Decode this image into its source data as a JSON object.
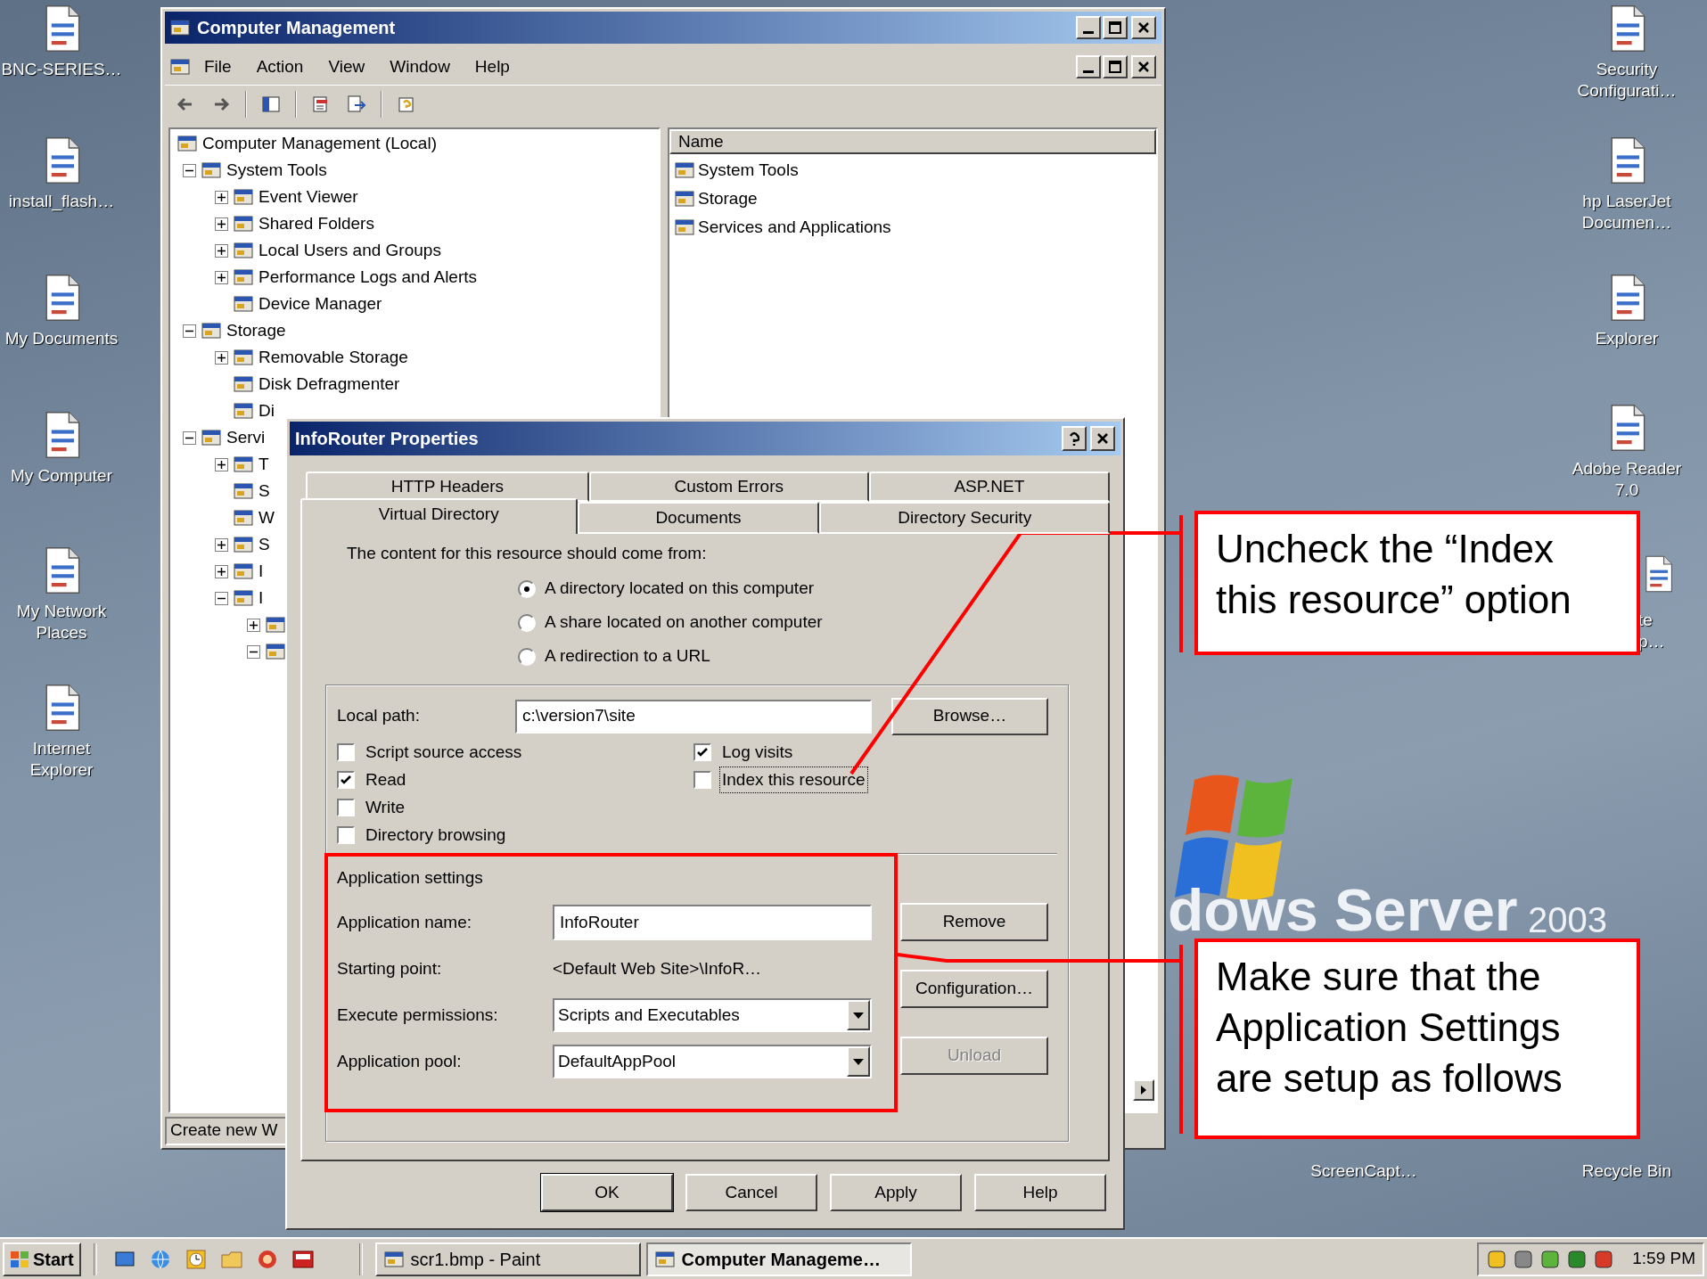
{
  "desktop": {
    "icons_left": [
      {
        "lines": [
          "BNC-SERIES…"
        ]
      },
      {
        "lines": [
          "install_flash…"
        ]
      },
      {
        "lines": [
          "My Documents"
        ]
      },
      {
        "lines": [
          "My Computer"
        ]
      },
      {
        "lines": [
          "My Network",
          "Places"
        ]
      },
      {
        "lines": [
          "Internet",
          "Explorer"
        ]
      }
    ],
    "icons_right": [
      {
        "lines": [
          "Security",
          "Configurati…"
        ]
      },
      {
        "lines": [
          "hp LaserJet",
          "Documen…"
        ]
      },
      {
        "lines": [
          "Explorer"
        ]
      },
      {
        "lines": [
          "Adobe Reader",
          "7.0"
        ]
      }
    ],
    "partial_icon": {
      "lines": [
        "te",
        "p…"
      ]
    },
    "bottom_labels": [
      "ScreenCapt…",
      "Recycle Bin"
    ],
    "wallpaper_text": "dows Server",
    "wallpaper_year": "2003"
  },
  "main_window": {
    "title": "Computer Management",
    "menu": [
      "File",
      "Action",
      "View",
      "Window",
      "Help"
    ],
    "tree": [
      {
        "label": "Computer Management (Local)",
        "children": [
          {
            "label": "System Tools",
            "expanded": true,
            "children": [
              {
                "label": "Event Viewer",
                "expanded": false
              },
              {
                "label": "Shared Folders",
                "expanded": false
              },
              {
                "label": "Local Users and Groups",
                "expanded": false
              },
              {
                "label": "Performance Logs and Alerts",
                "expanded": false
              },
              {
                "label": "Device Manager"
              }
            ]
          },
          {
            "label": "Storage",
            "expanded": true,
            "children": [
              {
                "label": "Removable Storage",
                "expanded": false
              },
              {
                "label": "Disk Defragmenter"
              },
              {
                "label": "Di"
              }
            ]
          },
          {
            "label": "Servi",
            "expanded": true,
            "children": [
              {
                "label": "T",
                "expanded": false
              },
              {
                "label": "S"
              },
              {
                "label": "W"
              },
              {
                "label": "S",
                "expanded": false
              },
              {
                "label": "I",
                "expanded": false
              },
              {
                "label": "I",
                "expanded": true,
                "children": [
                  {
                    "expanded": false
                  },
                  {
                    "expanded": true
                  }
                ]
              }
            ]
          }
        ]
      }
    ],
    "list": {
      "columns": [
        "Name"
      ],
      "items": [
        "System Tools",
        "Storage",
        "Services and Applications"
      ]
    },
    "status_bar": "Create new W"
  },
  "dialog": {
    "title": "InfoRouter Properties",
    "tabs_back": [
      {
        "label": "HTTP Headers",
        "selected": false
      },
      {
        "label": "Custom Errors",
        "selected": false
      },
      {
        "label": "ASP.NET",
        "selected": false
      }
    ],
    "tabs_front": [
      {
        "label": "Virtual Directory",
        "selected": true
      },
      {
        "label": "Documents",
        "selected": false
      },
      {
        "label": "Directory Security",
        "selected": false
      }
    ],
    "source_prompt": "The content for this resource should come from:",
    "source_options": [
      {
        "label": "A directory located on this computer",
        "selected": true
      },
      {
        "label": "A share located on another computer",
        "selected": false
      },
      {
        "label": "A redirection to a URL",
        "selected": false
      }
    ],
    "local_path_label": "Local path:",
    "local_path": "c:\\version7\\site",
    "browse_button": "Browse…",
    "checkboxes_left": [
      {
        "label": "Script source access",
        "checked": false,
        "focused": false
      },
      {
        "label": "Read",
        "checked": true,
        "focused": false
      },
      {
        "label": "Write",
        "checked": false,
        "focused": false
      },
      {
        "label": "Directory browsing",
        "checked": false,
        "focused": false
      }
    ],
    "checkboxes_right": [
      {
        "label": "Log visits",
        "checked": true,
        "focused": false
      },
      {
        "label": "Index this resource",
        "checked": false,
        "focused": true
      }
    ],
    "app_settings_title": "Application settings",
    "app_rows": [
      {
        "kind": "input",
        "label": "Application name:",
        "value": "InfoRouter"
      },
      {
        "kind": "text",
        "label": "Starting point:",
        "value": "<Default Web Site>\\InfoR…"
      },
      {
        "kind": "select",
        "label": "Execute permissions:",
        "value": "Scripts and Executables"
      },
      {
        "kind": "select",
        "label": "Application pool:",
        "value": "DefaultAppPool"
      }
    ],
    "app_buttons": [
      {
        "label": "Remove",
        "disabled": false
      },
      {
        "label": "Configuration…",
        "disabled": false
      },
      {
        "label": "Unload",
        "disabled": true
      }
    ],
    "buttons": [
      "OK",
      "Cancel",
      "Apply",
      "Help"
    ]
  },
  "callouts": [
    "Uncheck the “Index this resource” option",
    "Make sure that the Application Settings are setup as follows"
  ],
  "taskbar": {
    "start": "Start",
    "tasks": [
      {
        "label": "scr1.bmp - Paint",
        "selected": false
      },
      {
        "label": "Computer Manageme…",
        "selected": true
      }
    ],
    "clock": "1:59 PM"
  }
}
